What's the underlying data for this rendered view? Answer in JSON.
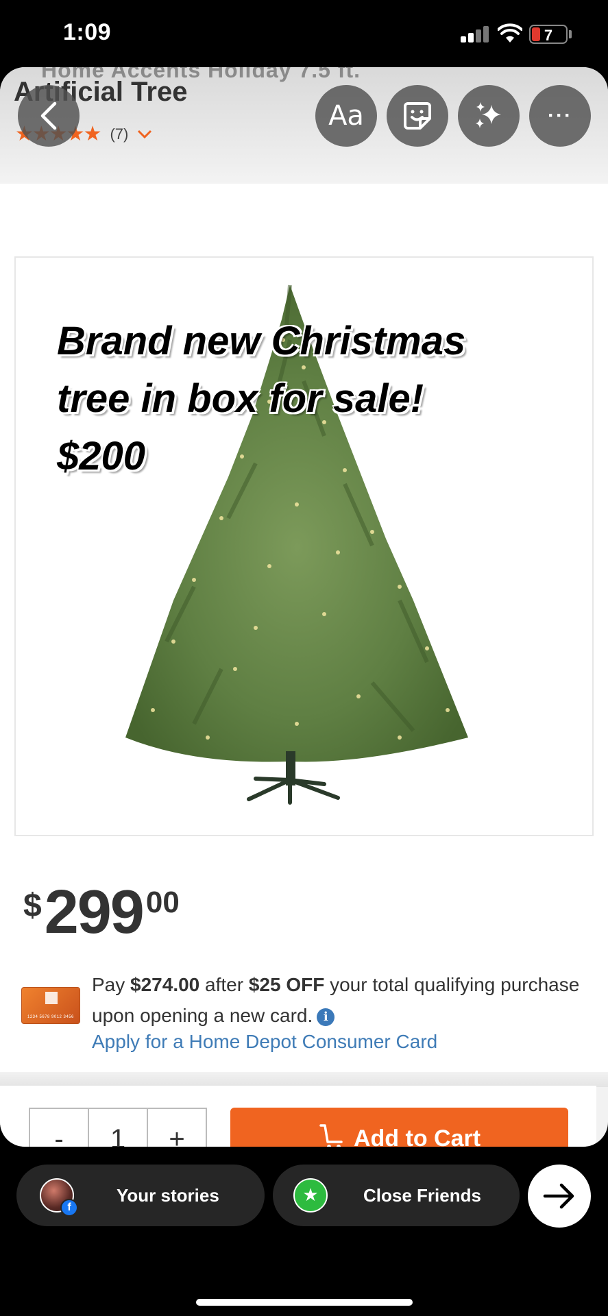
{
  "status_bar": {
    "time": "1:09",
    "battery": "7"
  },
  "product": {
    "brand_peek": "Home Accents Holiday 7.5 ft.",
    "title": "Artificial Tree",
    "stars": "★★★★★",
    "review_count": "(7)"
  },
  "story_tools": {
    "text_label": "Aa",
    "more_label": "···"
  },
  "image": {
    "caption": "Brand new Christmas\ntree in box for sale!\n$200",
    "carousel_dots": 3,
    "active_dot": 1
  },
  "price": {
    "currency": "$",
    "dollars": "299",
    "cents": "00"
  },
  "promo": {
    "pay_prefix": "Pay ",
    "pay_amount": "$274.00",
    "after": " after ",
    "discount": "$25 OFF",
    "rest": " your total qualifying purchase upon opening a new card.",
    "apply_link": "Apply for a Home Depot Consumer Card",
    "card_number": "1234 5678 9012 3456"
  },
  "cart": {
    "minus": "-",
    "quantity": "1",
    "plus": "+",
    "add_label": "Add to Cart"
  },
  "bottom_bar": {
    "your_stories": "Your stories",
    "close_friends": "Close Friends"
  },
  "colors": {
    "accent": "#f06420",
    "link": "#3e7bb6",
    "close_friends_green": "#2dbb3f"
  }
}
